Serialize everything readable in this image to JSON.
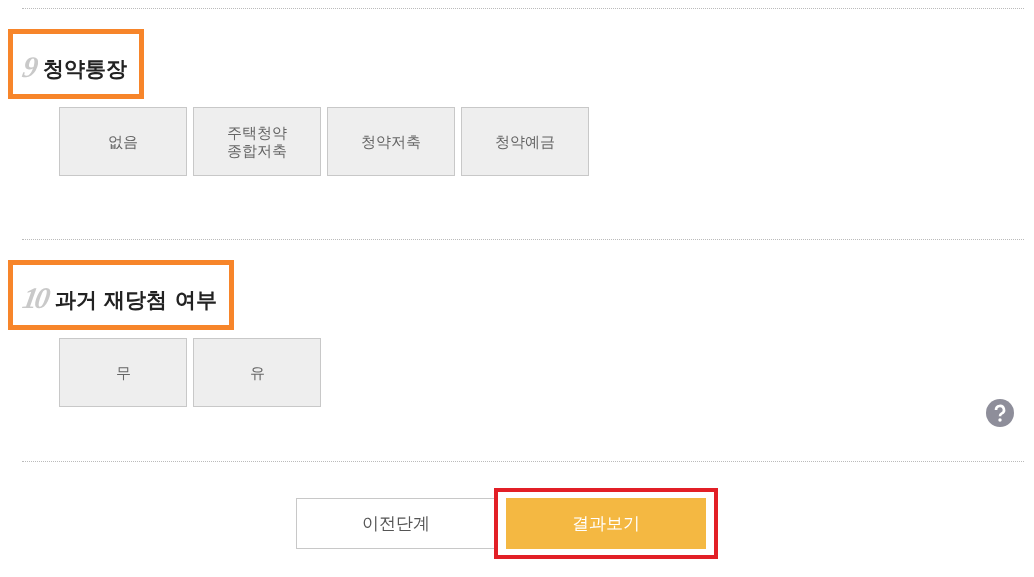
{
  "sections": [
    {
      "number": "9",
      "title": "청약통장",
      "highlighted": true,
      "options": [
        {
          "label": "없음",
          "selected": false
        },
        {
          "label": "주택청약\n종합저축",
          "selected": false
        },
        {
          "label": "청약저축",
          "selected": false
        },
        {
          "label": "청약예금",
          "selected": false
        }
      ]
    },
    {
      "number": "10",
      "title": "과거 재당첨 여부",
      "highlighted": true,
      "help": true,
      "options": [
        {
          "label": "무",
          "selected": false
        },
        {
          "label": "유",
          "selected": false
        }
      ]
    }
  ],
  "buttons": [
    {
      "label": "이전단계",
      "kind": "secondary",
      "highlighted": false
    },
    {
      "label": "결과보기",
      "kind": "primary",
      "highlighted": true
    }
  ]
}
